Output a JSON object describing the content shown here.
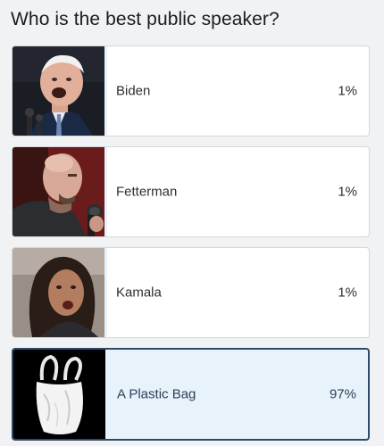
{
  "poll": {
    "question": "Who is the best public speaker?",
    "options": [
      {
        "label": "Biden",
        "percent_text": "1%",
        "percent": 1,
        "selected": false,
        "image": "biden-photo"
      },
      {
        "label": "Fetterman",
        "percent_text": "1%",
        "percent": 1,
        "selected": false,
        "image": "fetterman-photo"
      },
      {
        "label": "Kamala",
        "percent_text": "1%",
        "percent": 1,
        "selected": false,
        "image": "kamala-photo"
      },
      {
        "label": "A Plastic Bag",
        "percent_text": "97%",
        "percent": 97,
        "selected": true,
        "image": "plastic-bag-photo"
      }
    ]
  },
  "colors": {
    "page_background": "#f1f2f4",
    "option_background": "#ffffff",
    "selected_border": "#2c4a6a",
    "selected_background": "#e8f2fb"
  }
}
